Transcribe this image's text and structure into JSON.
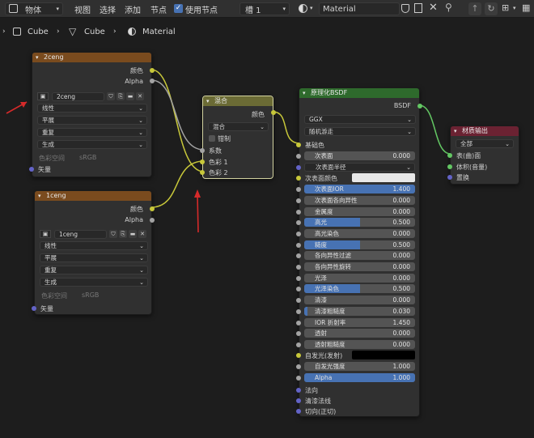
{
  "header": {
    "object_mode": "物体",
    "menu": [
      "视图",
      "选择",
      "添加",
      "节点"
    ],
    "use_nodes_label": "使用节点",
    "slot": "槽 1",
    "material": "Material"
  },
  "breadcrumb": [
    "Cube",
    "Cube",
    "Material"
  ],
  "node_2ceng": {
    "title": "2ceng",
    "out_color": "颜色",
    "out_alpha": "Alpha",
    "image": "2ceng",
    "interp": "线性",
    "proj": "平展",
    "ext": "重复",
    "src": "生成",
    "colorspace_label": "色彩空间",
    "colorspace": "sRGB",
    "vector": "矢量"
  },
  "node_1ceng": {
    "title": "1ceng",
    "out_color": "颜色",
    "out_alpha": "Alpha",
    "image": "1ceng",
    "interp": "线性",
    "proj": "平展",
    "ext": "重复",
    "src": "生成",
    "colorspace_label": "色彩空间",
    "colorspace": "sRGB",
    "vector": "矢量"
  },
  "node_mix": {
    "title": "混合",
    "out": "颜色",
    "mode": "混合",
    "clamp": "钳制",
    "fac": "系数",
    "c1": "色彩 1",
    "c2": "色彩 2"
  },
  "node_bsdf": {
    "title": "原理化BSDF",
    "out": "BSDF",
    "dist": "GGX",
    "sss": "随机游走",
    "base": "基础色",
    "emission": "自发光(发射)",
    "fields": [
      {
        "label": "次表面",
        "value": "0.000",
        "fill": 0
      },
      {
        "label": "次表面半径",
        "value": "",
        "fill": 0,
        "select": true
      },
      {
        "label": "次表面颜色",
        "value": "",
        "fill": 0,
        "swatch": "#e8e8e8"
      },
      {
        "label": "次表面IOR",
        "value": "1.400",
        "fill": 1
      },
      {
        "label": "次表面各向异性",
        "value": "0.000",
        "fill": 0
      },
      {
        "label": "金属度",
        "value": "0.000",
        "fill": 0
      },
      {
        "label": "高光",
        "value": "0.500",
        "fill": 0.5
      },
      {
        "label": "高光染色",
        "value": "0.000",
        "fill": 0
      },
      {
        "label": "糙度",
        "value": "0.500",
        "fill": 0.5
      },
      {
        "label": "各向异性过滤",
        "value": "0.000",
        "fill": 0
      },
      {
        "label": "各向异性旋转",
        "value": "0.000",
        "fill": 0
      },
      {
        "label": "光泽",
        "value": "0.000",
        "fill": 0
      },
      {
        "label": "光泽染色",
        "value": "0.500",
        "fill": 0.5
      },
      {
        "label": "清漆",
        "value": "0.000",
        "fill": 0
      },
      {
        "label": "清漆粗糙度",
        "value": "0.030",
        "fill": 0.03
      },
      {
        "label": "IOR 折射率",
        "value": "1.450",
        "fill": 0
      },
      {
        "label": "透射",
        "value": "0.000",
        "fill": 0
      },
      {
        "label": "透射粗糙度",
        "value": "0.000",
        "fill": 0
      }
    ],
    "em_strength": {
      "label": "自发光强度",
      "value": "1.000"
    },
    "alpha": {
      "label": "Alpha",
      "value": "1.000",
      "fill": 1
    },
    "normal": "法向",
    "cc_normal": "清漆法线",
    "tangent": "切向(正切)"
  },
  "node_output": {
    "title": "材质输出",
    "target": "全部",
    "surface": "表(曲)面",
    "volume": "体积(音量)",
    "disp": "置换"
  }
}
